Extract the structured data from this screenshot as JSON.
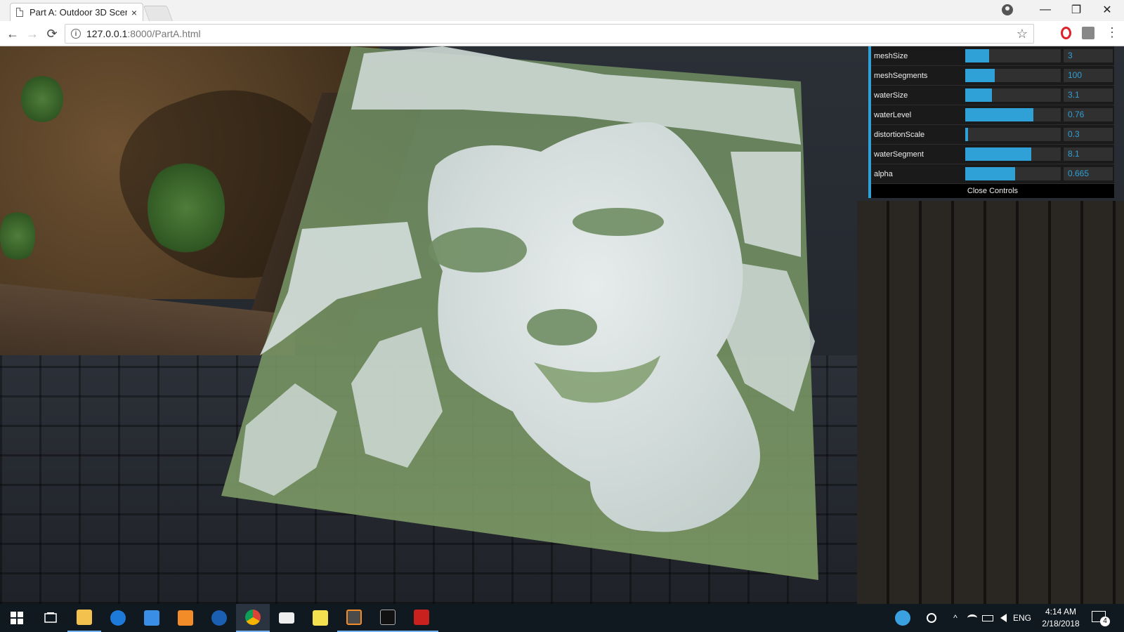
{
  "browser": {
    "tab_title": "Part A: Outdoor 3D Scen",
    "tab_close": "×",
    "url_host": "127.0.0.1",
    "url_rest": ":8000/PartA.html",
    "back_glyph": "←",
    "forward_glyph": "→",
    "reload_glyph": "⟳",
    "star_glyph": "☆",
    "menu_glyph": "⋮",
    "minimize_glyph": "—",
    "restore_glyph": "❐",
    "close_glyph": "✕",
    "info_glyph": "i"
  },
  "scene": {
    "description_icons": [
      "terrain-heightmap",
      "water-plane"
    ]
  },
  "controls": {
    "items": [
      {
        "label": "meshSize",
        "value": "3",
        "fill": 0.25
      },
      {
        "label": "meshSegments",
        "value": "100",
        "fill": 0.31
      },
      {
        "label": "waterSize",
        "value": "3.1",
        "fill": 0.28
      },
      {
        "label": "waterLevel",
        "value": "0.76",
        "fill": 0.71
      },
      {
        "label": "distortionScale",
        "value": "0.3",
        "fill": 0.03
      },
      {
        "label": "waterSegment",
        "value": "8.1",
        "fill": 0.69
      },
      {
        "label": "alpha",
        "value": "0.665",
        "fill": 0.52
      }
    ],
    "close_label": "Close Controls",
    "accent_color": "#2fa1d6"
  },
  "taskbar": {
    "apps": [
      "windows-start-icon",
      "task-view-icon",
      "file-explorer-icon",
      "edge-icon",
      "store-icon",
      "media-player-icon",
      "hp-icon",
      "chrome-icon",
      "mail-icon",
      "sticky-notes-icon",
      "sublime-text-icon",
      "terminal-icon",
      "filezilla-icon"
    ],
    "lang": "ENG",
    "time": "4:14 AM",
    "date": "2/18/2018",
    "notif_count": "4"
  }
}
